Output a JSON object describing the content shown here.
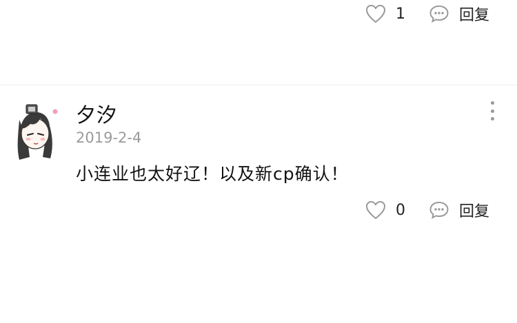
{
  "previous_comment": {
    "like_count": "1",
    "reply_label": "回复"
  },
  "comment": {
    "author": "夕汐",
    "date": "2019-2-4",
    "text": "小连业也太好辽！以及新cp确认！",
    "like_count": "0",
    "reply_label": "回复"
  },
  "icons": {
    "like": "heart-outline-icon",
    "reply": "speech-bubble-icon",
    "more": "vertical-dots-icon"
  },
  "colors": {
    "icon_stroke": "#9a9a9a",
    "date_text": "#9a9a9a",
    "divider": "#eeeeee"
  }
}
